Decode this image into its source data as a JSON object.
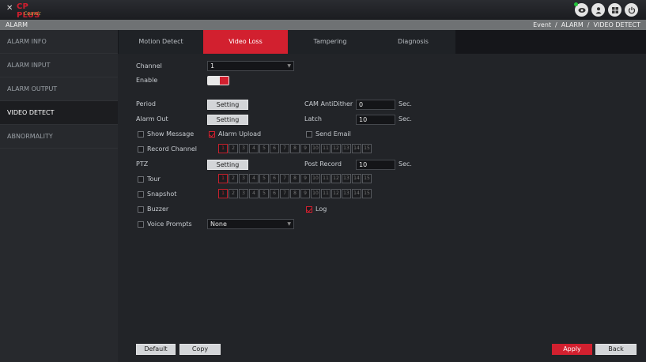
{
  "header": {
    "logo_brand": "CP PLUS",
    "logo_sub": "Cosmic",
    "icons": [
      "eye-icon",
      "user-icon",
      "menu-icon",
      "power-icon"
    ]
  },
  "pathbar": {
    "title": "ALARM",
    "breadcrumb": [
      "Event",
      "/",
      "ALARM",
      "/",
      "VIDEO DETECT"
    ]
  },
  "sidebar": {
    "items": [
      {
        "label": "ALARM INFO",
        "active": false
      },
      {
        "label": "ALARM INPUT",
        "active": false
      },
      {
        "label": "ALARM OUTPUT",
        "active": false
      },
      {
        "label": "VIDEO DETECT",
        "active": true
      },
      {
        "label": "ABNORMALITY",
        "active": false
      }
    ]
  },
  "tabs": [
    {
      "label": "Motion Detect",
      "active": false
    },
    {
      "label": "Video Loss",
      "active": true
    },
    {
      "label": "Tampering",
      "active": false
    },
    {
      "label": "Diagnosis",
      "active": false
    }
  ],
  "form": {
    "channel_label": "Channel",
    "channel_value": "1",
    "enable_label": "Enable",
    "enable_on": true,
    "period_label": "Period",
    "setting_label": "Setting",
    "cam_antidither_label": "CAM AntiDither",
    "cam_antidither_value": "0",
    "sec_unit": "Sec.",
    "alarm_out_label": "Alarm Out",
    "latch_label": "Latch",
    "latch_value": "10",
    "show_message_label": "Show Message",
    "show_message_checked": false,
    "alarm_upload_label": "Alarm Upload",
    "alarm_upload_checked": true,
    "send_email_label": "Send Email",
    "send_email_checked": false,
    "record_channel_label": "Record Channel",
    "record_channel_checked": false,
    "ptz_label": "PTZ",
    "post_record_label": "Post Record",
    "post_record_value": "10",
    "tour_label": "Tour",
    "tour_checked": false,
    "snapshot_label": "Snapshot",
    "snapshot_checked": false,
    "buzzer_label": "Buzzer",
    "buzzer_checked": false,
    "log_label": "Log",
    "log_checked": true,
    "voice_prompts_label": "Voice Prompts",
    "voice_prompts_checked": false,
    "voice_prompts_value": "None",
    "channels": [
      "1",
      "2",
      "3",
      "4",
      "5",
      "6",
      "7",
      "8",
      "9",
      "10",
      "11",
      "12",
      "13",
      "14",
      "15"
    ],
    "selected_channel": "1"
  },
  "footer": {
    "default_label": "Default",
    "copy_label": "Copy",
    "apply_label": "Apply",
    "back_label": "Back"
  },
  "colors": {
    "accent": "#d2202f",
    "background": "#1e1f23",
    "sidebar": "#27292d"
  }
}
